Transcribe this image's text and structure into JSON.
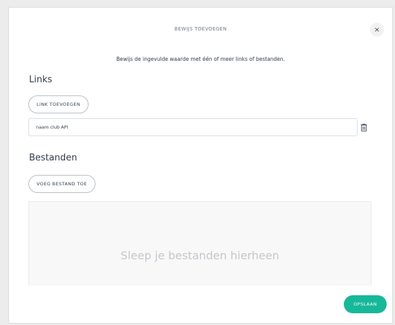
{
  "dialog": {
    "title": "BEWIJS TOEVOEGEN",
    "close_label": "×",
    "intro": "Bewijs de ingevulde waarde met één of meer links of bestanden."
  },
  "links": {
    "heading": "Links",
    "add_label": "LINK TOEVOEGEN",
    "items": [
      {
        "value": "naam club API"
      }
    ]
  },
  "files": {
    "heading": "Bestanden",
    "add_label": "VOEG BESTAND TOE",
    "dropzone_text": "Sleep je bestanden hierheen"
  },
  "footer": {
    "save_label": "OPSLAAN"
  },
  "colors": {
    "accent": "#17b89a",
    "text": "#2f3d4a",
    "muted": "#c3c7cb"
  }
}
